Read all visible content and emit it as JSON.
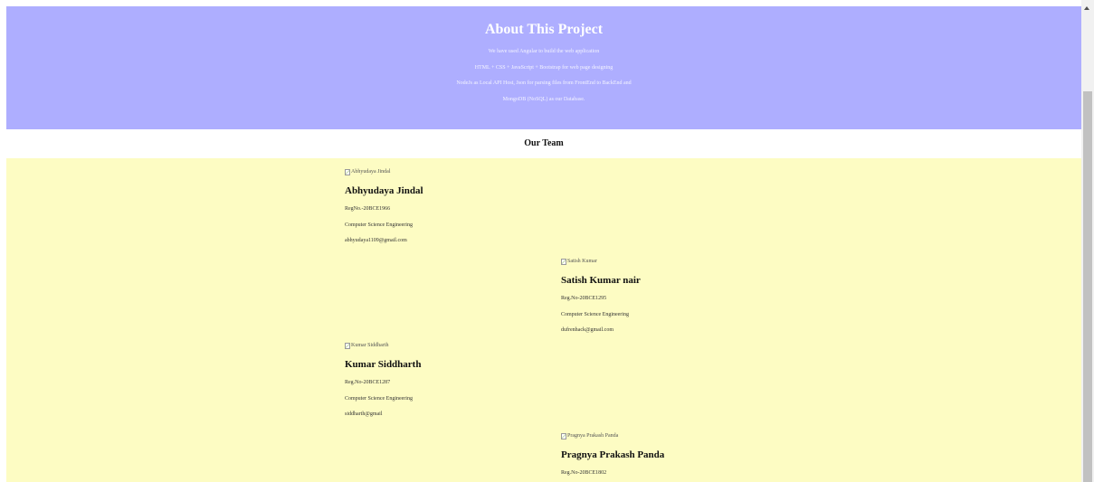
{
  "about": {
    "title": "About This Project",
    "lines": [
      "We have used Angular to build the web application",
      "HTML + CSS + JavaScript + Bootstrap for web page designing",
      "NodeJs as Local API Host, Json for parsing files from FrontEnd to BackEnd and",
      "MongoDB (NoSQL) as our Database."
    ]
  },
  "team": {
    "heading": "Our Team",
    "members": [
      {
        "img_alt": "Abhyudaya Jindal",
        "name": "Abhyudaya Jindal",
        "reg": "RegNo.-20BCE1966",
        "dept": "Computer Science Engineering",
        "email": "abhyudaya1109@gmail.com"
      },
      {
        "img_alt": "Satish Kumar",
        "name": "Satish Kumar nair",
        "reg": "Reg.No-20BCE1295",
        "dept": "Computer Science Engineering",
        "email": "dufrenhack@gmail.com"
      },
      {
        "img_alt": "Kumar Siddharth",
        "name": "Kumar Siddharth",
        "reg": "Reg.No-20BCE1287",
        "dept": "Computer Science Engineering",
        "email": "siddharth@gmail"
      },
      {
        "img_alt": "Pragnya Prakash Panda",
        "name": "Pragnya Prakash Panda",
        "reg": "Reg.No-20BCE1802",
        "dept": "",
        "email": ""
      }
    ]
  },
  "colors": {
    "about_bg": "#aeaeff",
    "team_bg": "#fdfcc3",
    "heading_bg": "#ffffff"
  },
  "icons": {
    "broken_image": "broken-image-icon",
    "scroll_up": "scroll-up-arrow-icon"
  }
}
